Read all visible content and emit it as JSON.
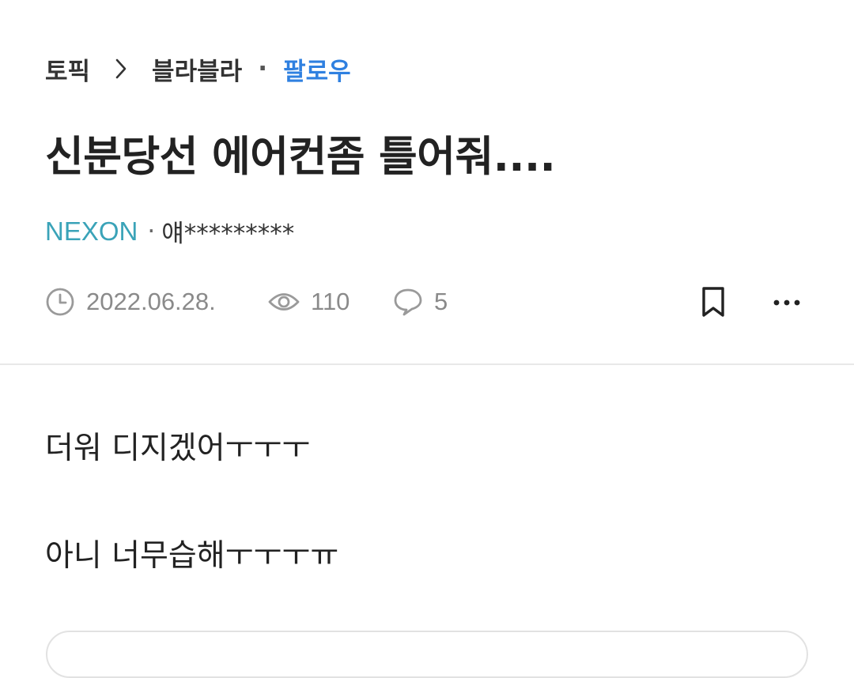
{
  "breadcrumb": {
    "topic": "토픽",
    "board": "블라블라",
    "separator": "·",
    "follow": "팔로우"
  },
  "post": {
    "title": "신분당선 에어컨좀 틀어줘....",
    "company": "NEXON",
    "author_separator": "·",
    "author": "얘*********",
    "date": "2022.06.28.",
    "views": "110",
    "comments": "5",
    "body": [
      "더워 디지겠어ㅜㅜㅜ",
      "아니 너무습해ㅜㅜㅜㅠ"
    ]
  },
  "colors": {
    "accent_blue": "#2f80e0",
    "company_teal": "#3aa3b8",
    "meta_gray": "#8a8a8a"
  },
  "icons": {
    "breadcrumb_sep": "chevron-right-icon",
    "date": "clock-icon",
    "views": "eye-icon",
    "comments": "comment-bubble-icon",
    "bookmark": "bookmark-icon",
    "more": "more-horizontal-icon"
  }
}
